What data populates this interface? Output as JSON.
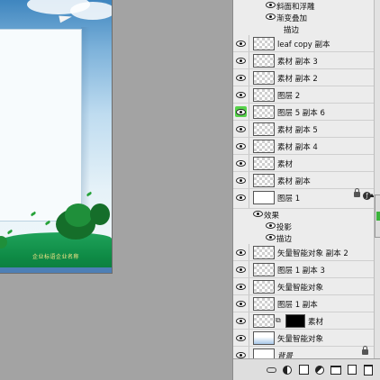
{
  "canvas": {
    "caption": "企业标语企业名称"
  },
  "layers_panel": {
    "rows": [
      {
        "kind": "effect",
        "name": "斜面和浮雕",
        "indent": 2
      },
      {
        "kind": "effect",
        "name": "渐变叠加",
        "indent": 2
      },
      {
        "kind": "effect",
        "name": "描边",
        "indent": 3
      },
      {
        "kind": "layer",
        "name": "leaf copy 副本",
        "thumb": "transparent"
      },
      {
        "kind": "layer",
        "name": "素材 副本 3",
        "thumb": "transparent"
      },
      {
        "kind": "layer",
        "name": "素材 副本 2",
        "thumb": "transparent"
      },
      {
        "kind": "layer",
        "name": "图层 2",
        "thumb": "transparent"
      },
      {
        "kind": "layer",
        "name": "图层 5 副本 6",
        "thumb": "transparent",
        "active": true
      },
      {
        "kind": "layer",
        "name": "素材 副本 5",
        "thumb": "transparent"
      },
      {
        "kind": "layer",
        "name": "素材 副本 4",
        "thumb": "transparent"
      },
      {
        "kind": "layer",
        "name": "素材",
        "thumb": "transparent"
      },
      {
        "kind": "layer",
        "name": "素材 副本",
        "thumb": "transparent"
      },
      {
        "kind": "layer",
        "name": "图层 1",
        "thumb": "white",
        "locked": true,
        "fx": true,
        "tall": true
      },
      {
        "kind": "effect",
        "name": "效果",
        "indent": 1
      },
      {
        "kind": "effect",
        "name": "投影",
        "indent": 2
      },
      {
        "kind": "effect",
        "name": "描边",
        "indent": 2
      },
      {
        "kind": "layer",
        "name": "矢量智能对象 副本 2",
        "thumb": "transparent"
      },
      {
        "kind": "layer",
        "name": "图层 1 副本 3",
        "thumb": "transparent"
      },
      {
        "kind": "layer",
        "name": "矢量智能对象",
        "thumb": "transparent"
      },
      {
        "kind": "layer",
        "name": "图层 1 副本",
        "thumb": "transparent"
      },
      {
        "kind": "layer",
        "name": "素材",
        "thumb": "transparent",
        "mask": true
      },
      {
        "kind": "layer",
        "name": "矢量智能对象",
        "thumb": "blue"
      },
      {
        "kind": "layer",
        "name": "背景",
        "thumb": "white",
        "locked": true,
        "italic": true
      }
    ],
    "toolbar": {
      "icons": [
        "link-layers-icon",
        "add-layer-style-icon",
        "add-mask-icon",
        "adjustment-layer-icon",
        "new-group-icon",
        "new-layer-icon",
        "delete-layer-icon"
      ]
    }
  }
}
